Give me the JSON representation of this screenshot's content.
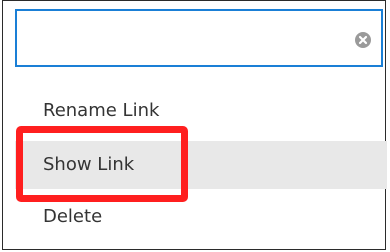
{
  "search": {
    "value": "",
    "clear_icon": "clear-circle-icon"
  },
  "menu": {
    "items": [
      {
        "label": "Rename Link"
      },
      {
        "label": "Show Link",
        "highlighted": true
      },
      {
        "label": "Delete"
      }
    ]
  },
  "colors": {
    "focus_border": "#1a7fd6",
    "highlight_bg": "#e8e8e8",
    "callout": "#ff1f1f"
  }
}
